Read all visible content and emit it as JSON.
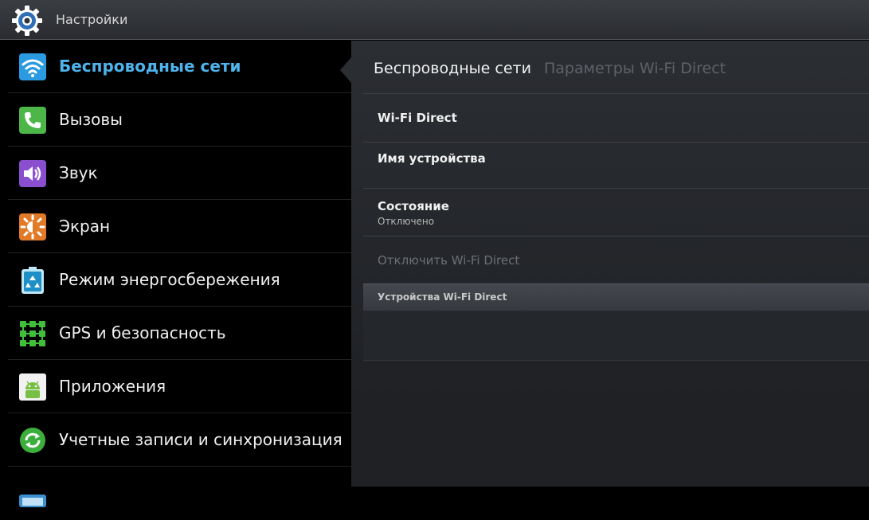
{
  "app": {
    "title": "Настройки",
    "icon": "gear-icon"
  },
  "sidebar": {
    "items": [
      {
        "label": "Беспроводные сети",
        "icon": "wifi-icon",
        "active": true
      },
      {
        "label": "Вызовы",
        "icon": "phone-icon"
      },
      {
        "label": "Звук",
        "icon": "speaker-icon"
      },
      {
        "label": "Экран",
        "icon": "brightness-icon"
      },
      {
        "label": "Режим энергосбережения",
        "icon": "battery-recycle-icon"
      },
      {
        "label": "GPS и безопасность",
        "icon": "gps-grid-icon"
      },
      {
        "label": "Приложения",
        "icon": "android-icon"
      },
      {
        "label": "Учетные записи и синхронизация",
        "icon": "sync-icon"
      }
    ]
  },
  "panel": {
    "breadcrumb": {
      "current": "Беспроводные сети",
      "next": "Параметры Wi-Fi Direct"
    },
    "wifi_direct": {
      "title": "Wi-Fi Direct"
    },
    "device_name": {
      "title": "Имя устройства"
    },
    "status": {
      "title": "Состояние",
      "value": "Отключено"
    },
    "disconnect": {
      "title": "Отключить Wi-Fi Direct"
    },
    "devices_section": {
      "header": "Устройства Wi-Fi Direct"
    }
  },
  "colors": {
    "accent": "#4fb3ec",
    "topbar": "#2f3236",
    "panel": "#26292d"
  }
}
